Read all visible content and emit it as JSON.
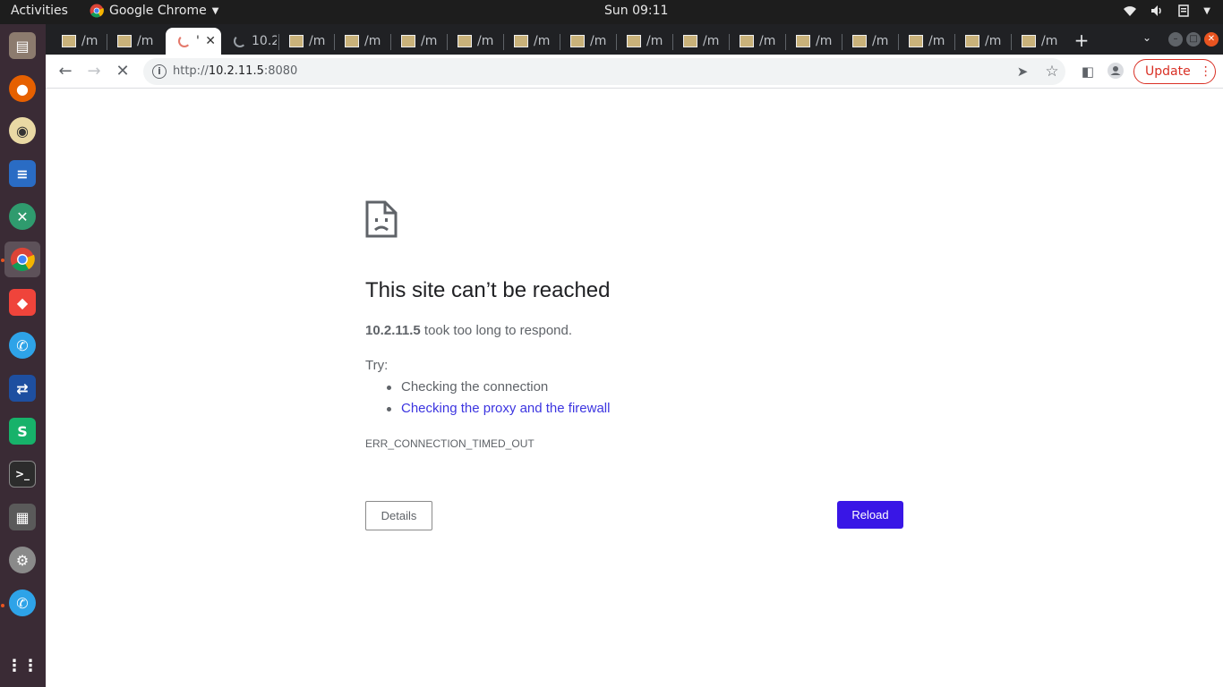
{
  "topbar": {
    "activities": "Activities",
    "app_name": "Google Chrome",
    "clock": "Sun 09:11"
  },
  "dock": {
    "items": [
      {
        "name": "files-icon",
        "color": "#7a6a5f"
      },
      {
        "name": "firefox-icon",
        "color": "#e66000"
      },
      {
        "name": "rhythmbox-icon",
        "color": "#d9a520"
      },
      {
        "name": "libreoffice-writer-icon",
        "color": "#2a6cc4"
      },
      {
        "name": "remmina-icon",
        "color": "#2f9b6e"
      },
      {
        "name": "chrome-icon",
        "color": "#4285f4"
      },
      {
        "name": "anydesk-icon",
        "color": "#ef443b"
      },
      {
        "name": "phone-icon",
        "color": "#2ea3e8"
      },
      {
        "name": "network-tool-icon",
        "color": "#1e4fa0"
      },
      {
        "name": "wps-spreadsheet-icon",
        "color": "#17b26a"
      },
      {
        "name": "terminal-icon",
        "color": "#2c2c2c"
      },
      {
        "name": "calculator-icon",
        "color": "#5a5a5a"
      },
      {
        "name": "settings-tool-icon",
        "color": "#7a7a7a"
      },
      {
        "name": "phone-icon-2",
        "color": "#2ea3e8"
      },
      {
        "name": "show-apps-icon",
        "color": "#3a2b35"
      }
    ]
  },
  "tabs": {
    "generic_label": "/m",
    "loading_tab_label": "10.2",
    "active_tab_label": "'",
    "new_tab": "+"
  },
  "toolbar": {
    "url_scheme": "http://",
    "url_host": "10.2.11.5",
    "url_port": ":8080",
    "update_label": "Update"
  },
  "error_page": {
    "title": "This site can’t be reached",
    "host": "10.2.11.5",
    "desc_rest": " took too long to respond.",
    "try_label": "Try:",
    "suggestions": [
      "Checking the connection",
      "Checking the proxy and the firewall"
    ],
    "error_code": "ERR_CONNECTION_TIMED_OUT",
    "details_label": "Details",
    "reload_label": "Reload"
  }
}
